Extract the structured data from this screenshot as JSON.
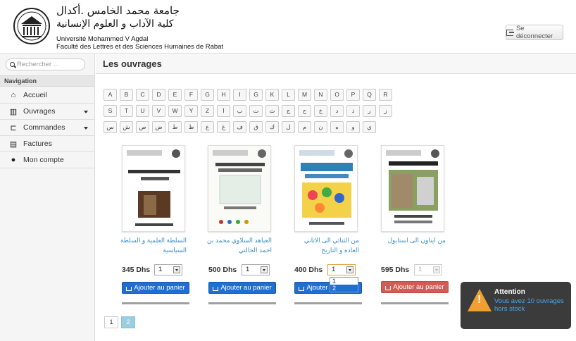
{
  "header": {
    "university_ar_line1": "جامعة محمد الخامس .أكدال",
    "university_ar_line2": "كلية الآداب و العلوم الإنسانية",
    "university_fr": "Université Mohammed V Agdal",
    "faculty_fr": "Faculté des Lettres et des Sciences Humaines de Rabat",
    "logout_label": "Se déconnecter"
  },
  "sidebar": {
    "search_placeholder": "Rechercher ...",
    "nav_heading": "Navigation",
    "items": [
      {
        "label": "Accueil",
        "icon": "home-icon"
      },
      {
        "label": "Ouvrages",
        "icon": "books-icon"
      },
      {
        "label": "Commandes",
        "icon": "cart-icon"
      },
      {
        "label": "Factures",
        "icon": "invoice-icon"
      },
      {
        "label": "Mon compte",
        "icon": "user-icon"
      }
    ]
  },
  "main": {
    "title": "Les ouvrages"
  },
  "alphabet": {
    "row1": [
      "A",
      "B",
      "C",
      "D",
      "E",
      "F",
      "G",
      "H",
      "I",
      "G",
      "K",
      "L",
      "M",
      "N",
      "O",
      "P",
      "Q",
      "R"
    ],
    "row2": [
      "S",
      "T",
      "U",
      "V",
      "W",
      "Y",
      "Z",
      "ا",
      "ب",
      "ت",
      "ث",
      "ج",
      "ح",
      "خ",
      "د",
      "ذ",
      "ر",
      "ز"
    ],
    "row3": [
      "س",
      "ش",
      "ص",
      "ض",
      "ط",
      "ظ",
      "ع",
      "غ",
      "ف",
      "ق",
      "ك",
      "ل",
      "م",
      "ن",
      "ه",
      "و",
      "ي"
    ]
  },
  "books": [
    {
      "title": "السلطة العلمية و السلطة السياسية",
      "price": "345 Dhs",
      "qty": "1",
      "button": "Ajouter au panier",
      "available": true
    },
    {
      "title": "العباهد السلاوي محمد بن احمد الجالتي",
      "price": "500 Dhs",
      "qty": "1",
      "button": "Ajouter au panier",
      "available": true
    },
    {
      "title": "من الثنائي الى الاثاني العادة و التاريخ",
      "price": "400 Dhs",
      "qty": "1",
      "button": "Ajouter au panier",
      "available": true
    },
    {
      "title": "من ايناون الى استايول",
      "price": "595 Dhs",
      "qty": "1",
      "button": "Ajouter au panier",
      "available": false
    }
  ],
  "dropdown_options": [
    "1",
    "2"
  ],
  "pager": [
    "1",
    "2"
  ],
  "toast": {
    "title": "Attention",
    "message": "Vous avez 10 ouvrages hors stock"
  },
  "colors": {
    "primary_button": "#1f6fd1",
    "danger_button": "#d35b55",
    "link": "#3a8dc4",
    "warning": "#f0a030"
  }
}
